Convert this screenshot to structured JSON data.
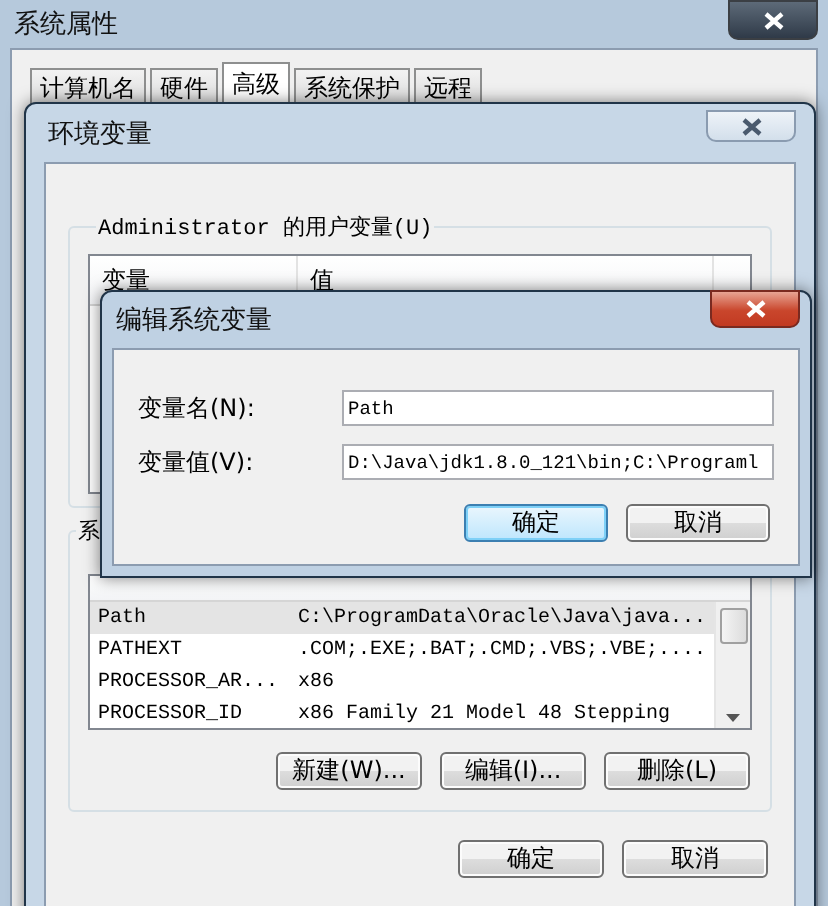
{
  "window": {
    "title": "系统属性"
  },
  "tabs": [
    {
      "label": "计算机名",
      "selected": false
    },
    {
      "label": "硬件",
      "selected": false
    },
    {
      "label": "高级",
      "selected": true
    },
    {
      "label": "系统保护",
      "selected": false
    },
    {
      "label": "远程",
      "selected": false
    }
  ],
  "env_dialog": {
    "title": "环境变量",
    "user_group": {
      "label": "Administrator 的用户变量(U)",
      "columns": [
        "变量",
        "值"
      ]
    },
    "system_group": {
      "label": "系",
      "rows": [
        {
          "name": "Path",
          "value": "C:\\ProgramData\\Oracle\\Java\\java...",
          "selected": true
        },
        {
          "name": "PATHEXT",
          "value": ".COM;.EXE;.BAT;.CMD;.VBS;.VBE;....",
          "selected": false
        },
        {
          "name": "PROCESSOR_AR...",
          "value": "x86",
          "selected": false
        },
        {
          "name": "PROCESSOR_ID",
          "value": "x86 Family 21 Model 48 Stepping",
          "selected": false
        }
      ],
      "buttons": [
        "新建(W)...",
        "编辑(I)...",
        "删除(L)"
      ]
    },
    "buttons": [
      "确定",
      "取消"
    ]
  },
  "edit_dialog": {
    "title": "编辑系统变量",
    "fields": [
      {
        "label": "变量名(N):",
        "value": "Path"
      },
      {
        "label": "变量值(V):",
        "value": "D:\\Java\\jdk1.8.0_121\\bin;C:\\Programl"
      }
    ],
    "buttons": [
      {
        "label": "确定",
        "default": true
      },
      {
        "label": "取消",
        "default": false
      }
    ]
  }
}
